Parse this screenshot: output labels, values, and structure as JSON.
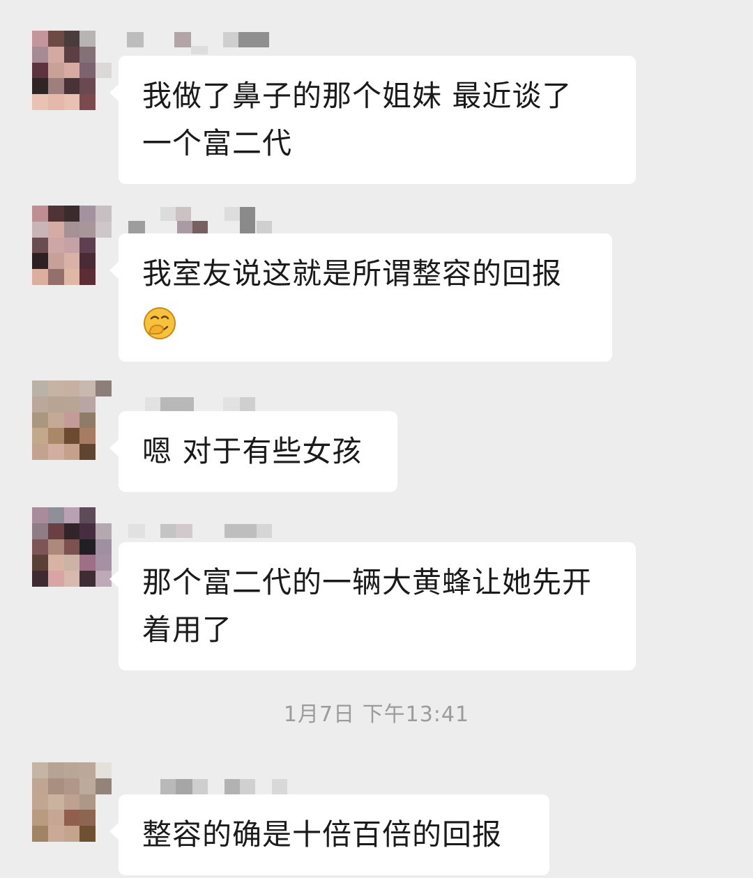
{
  "messages": [
    {
      "text": "我做了鼻子的那个姐妹 最近谈了\n一个富二代"
    },
    {
      "text": "我室友说这就是所谓整容的回报",
      "emoji": "smirk-hand-emoji"
    },
    {
      "text": "嗯 对于有些女孩"
    },
    {
      "text": "那个富二代的一辆大黄蜂让她先开\n着用了"
    },
    {
      "text": "整容的确是十倍百倍的回报"
    }
  ],
  "timestamp": "1月7日 下午13:41",
  "colors": {
    "background": "#ededed",
    "bubble": "#ffffff",
    "text": "#1a1a1a",
    "timestamp": "#9b9b9b"
  }
}
